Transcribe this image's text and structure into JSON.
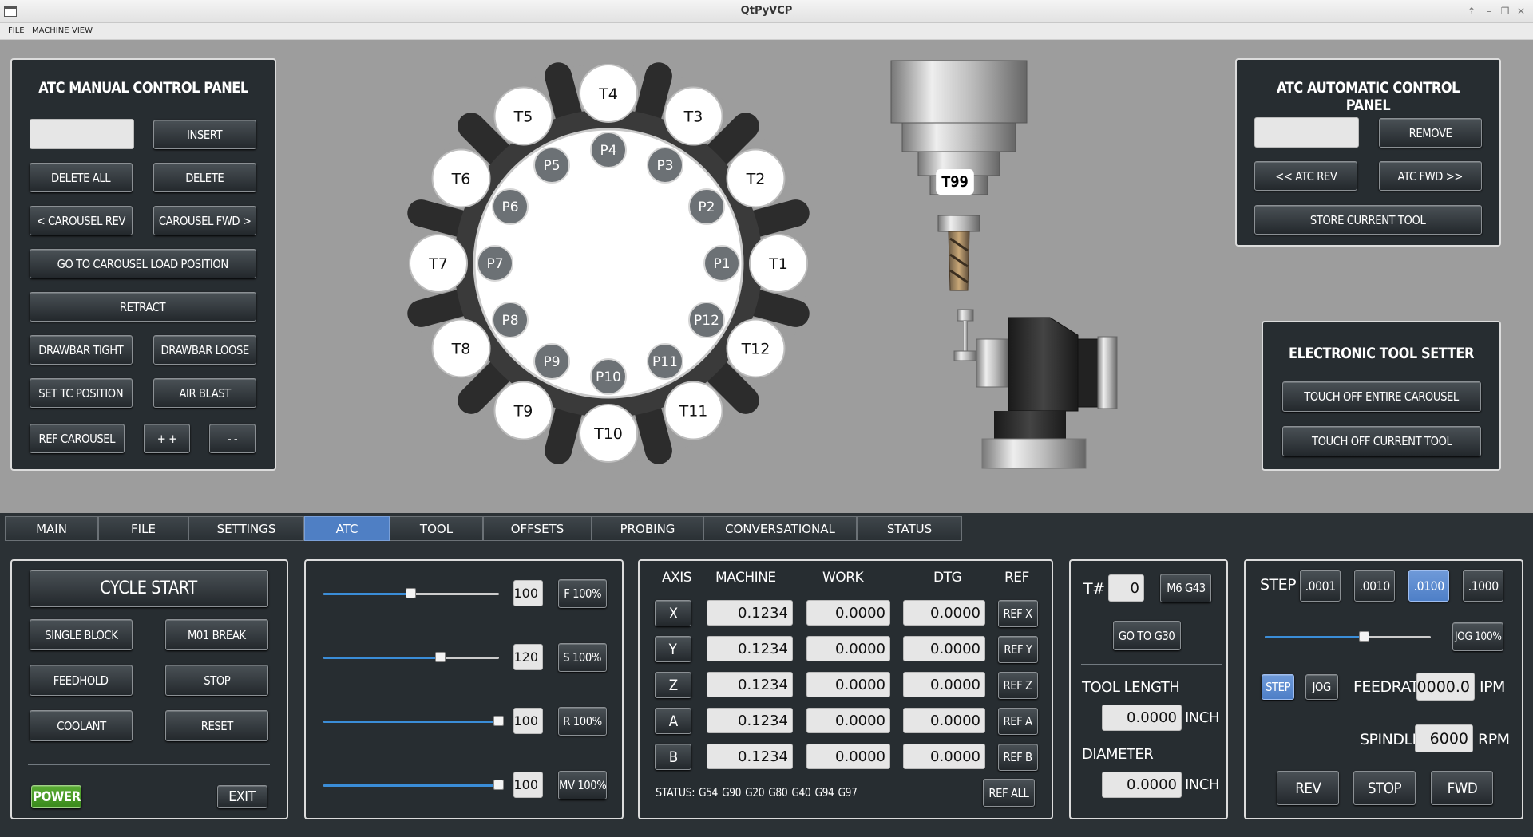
{
  "window": {
    "title": "QtPyVCP"
  },
  "menu": [
    "FILE",
    "MACHINE",
    "VIEW"
  ],
  "manual_panel": {
    "title": "ATC MANUAL CONTROL PANEL",
    "input_value": "",
    "insert": "INSERT",
    "delete_all": "DELETE ALL",
    "delete": "DELETE",
    "carousel_rev": "< CAROUSEL REV",
    "carousel_fwd": "CAROUSEL FWD >",
    "go_load": "GO TO CAROUSEL LOAD POSITION",
    "retract": "RETRACT",
    "drawbar_tight": "DRAWBAR TIGHT",
    "drawbar_loose": "DRAWBAR LOOSE",
    "set_tc": "SET TC POSITION",
    "air_blast": "AIR BLAST",
    "ref_carousel": "REF CAROUSEL",
    "plus": "+ +",
    "minus": "- -"
  },
  "carousel": {
    "tools": [
      "T1",
      "T2",
      "T3",
      "T4",
      "T5",
      "T6",
      "T7",
      "T8",
      "T9",
      "T10",
      "T11",
      "T12"
    ],
    "pockets": [
      "P1",
      "P2",
      "P3",
      "P4",
      "P5",
      "P6",
      "P7",
      "P8",
      "P9",
      "P10",
      "P11",
      "P12"
    ]
  },
  "spindle_tool": "T99",
  "auto_panel": {
    "title": "ATC AUTOMATIC CONTROL PANEL",
    "input_value": "",
    "remove": "REMOVE",
    "atc_rev": "<< ATC REV",
    "atc_fwd": "ATC FWD >>",
    "store": "STORE CURRENT TOOL"
  },
  "tool_setter": {
    "title": "ELECTRONIC TOOL SETTER",
    "touch_all": "TOUCH OFF ENTIRE CAROUSEL",
    "touch_current": "TOUCH OFF CURRENT TOOL"
  },
  "tabs": [
    {
      "label": "MAIN",
      "active": false
    },
    {
      "label": "FILE",
      "active": false
    },
    {
      "label": "SETTINGS",
      "active": false
    },
    {
      "label": "ATC",
      "active": true
    },
    {
      "label": "TOOL",
      "active": false
    },
    {
      "label": "OFFSETS",
      "active": false
    },
    {
      "label": "PROBING",
      "active": false
    },
    {
      "label": "CONVERSATIONAL",
      "active": false
    },
    {
      "label": "STATUS",
      "active": false
    }
  ],
  "control": {
    "cycle_start": "CYCLE START",
    "single_block": "SINGLE BLOCK",
    "m01_break": "M01 BREAK",
    "feedhold": "FEEDHOLD",
    "stop": "STOP",
    "coolant": "COOLANT",
    "reset": "RESET",
    "power": "POWER",
    "exit": "EXIT"
  },
  "overrides": [
    {
      "value": "100",
      "button": "F 100%",
      "level": 0.5
    },
    {
      "value": "120",
      "button": "S 100%",
      "level": 0.67
    },
    {
      "value": "100",
      "button": "R 100%",
      "level": 1.0
    },
    {
      "value": "100",
      "button": "MV 100%",
      "level": 1.0
    }
  ],
  "dro": {
    "headers": {
      "axis": "AXIS",
      "machine": "MACHINE",
      "work": "WORK",
      "dtg": "DTG",
      "ref": "REF"
    },
    "rows": [
      {
        "axis": "X",
        "machine": "0.1234",
        "work": "0.0000",
        "dtg": "0.0000",
        "ref": "REF X"
      },
      {
        "axis": "Y",
        "machine": "0.1234",
        "work": "0.0000",
        "dtg": "0.0000",
        "ref": "REF Y"
      },
      {
        "axis": "Z",
        "machine": "0.1234",
        "work": "0.0000",
        "dtg": "0.0000",
        "ref": "REF Z"
      },
      {
        "axis": "A",
        "machine": "0.1234",
        "work": "0.0000",
        "dtg": "0.0000",
        "ref": "REF A"
      },
      {
        "axis": "B",
        "machine": "0.1234",
        "work": "0.0000",
        "dtg": "0.0000",
        "ref": "REF B"
      }
    ],
    "status_label": "STATUS:",
    "status_codes": "G54  G90  G20  G80  G40  G94  G97",
    "ref_all": "REF ALL"
  },
  "tool": {
    "t_label": "T#",
    "t_value": "0",
    "m6g43": "M6 G43",
    "go_g30": "GO TO G30",
    "length_label": "TOOL LENGTH",
    "length_value": "0.0000",
    "length_unit": "INCH",
    "diameter_label": "DIAMETER",
    "diameter_value": "0.0000",
    "diameter_unit": "INCH"
  },
  "jog": {
    "step_label": "STEP",
    "steps": [
      {
        "label": ".0001",
        "active": false
      },
      {
        "label": ".0010",
        "active": false
      },
      {
        "label": ".0100",
        "active": true
      },
      {
        "label": ".1000",
        "active": false
      }
    ],
    "jog_pct": "JOG 100%",
    "jog_level": 0.6,
    "mode_step": "STEP",
    "mode_jog": "JOG",
    "feedrate_label": "FEEDRATE",
    "feedrate_value": "0000.0",
    "feedrate_unit": "IPM",
    "spindle_label": "SPINDLE",
    "spindle_value": "6000",
    "spindle_unit": "RPM",
    "rev": "REV",
    "stop": "STOP",
    "fwd": "FWD"
  },
  "colors": {
    "accent": "#4f7fc4",
    "panel": "#272d31",
    "power": "#3a8a1c",
    "slider": "#3a8dd8"
  }
}
